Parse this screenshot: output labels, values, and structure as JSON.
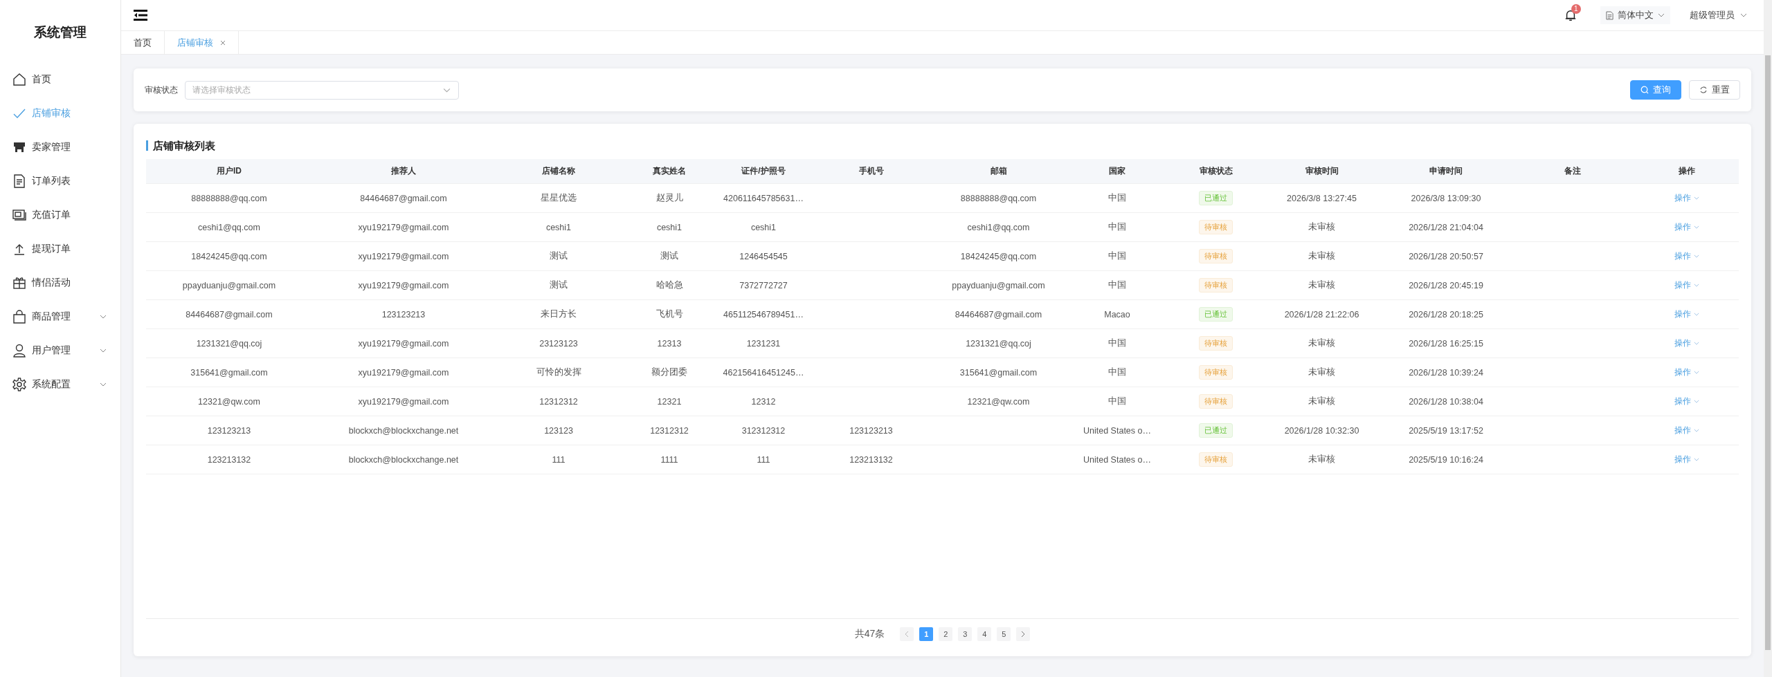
{
  "sidebar": {
    "title": "系统管理",
    "items": [
      {
        "label": "首页",
        "selected": false
      },
      {
        "label": "店铺审核",
        "selected": true
      },
      {
        "label": "卖家管理",
        "selected": false
      },
      {
        "label": "订单列表",
        "selected": false
      },
      {
        "label": "充值订单",
        "selected": false
      },
      {
        "label": "提现订单",
        "selected": false
      },
      {
        "label": "情侣活动",
        "selected": false
      },
      {
        "label": "商品管理",
        "selected": false,
        "expanded": false
      },
      {
        "label": "用户管理",
        "selected": false,
        "expanded": false
      },
      {
        "label": "系统配置",
        "selected": false,
        "expanded": false
      }
    ]
  },
  "header": {
    "notification_count": "1",
    "language": "简体中文",
    "user": "超级管理员"
  },
  "tabs": [
    {
      "label": "首页",
      "selected": false,
      "closable": false
    },
    {
      "label": "店铺审核",
      "selected": true,
      "closable": true
    }
  ],
  "filter": {
    "label": "审核状态",
    "placeholder": "请选择审核状态",
    "buttons": [
      {
        "label": "查询",
        "kind": "primary"
      },
      {
        "label": "重置",
        "kind": "default"
      }
    ]
  },
  "table": {
    "title": "店铺审核列表",
    "columns": [
      "用户ID",
      "推荐人",
      "店铺名称",
      "真实姓名",
      "证件/护照号",
      "手机号",
      "邮箱",
      "国家",
      "审核状态",
      "审核时间",
      "申请时间",
      "备注",
      "操作"
    ],
    "rows": [
      {
        "cells": [
          "88888888@qq.com",
          "84464687@gmail.com",
          "星星优选",
          "赵灵儿",
          "420611645785631…",
          "",
          "88888888@qq.com",
          "中国"
        ],
        "status": {
          "text": "已通过",
          "kind": "approved"
        },
        "review_time": "2026/3/8 13:27:45",
        "apply_time": "2026/3/8 13:09:30",
        "action": "操作"
      },
      {
        "cells": [
          "ceshi1@qq.com",
          "xyu192179@gmail.com",
          "ceshi1",
          "ceshi1",
          "ceshi1",
          "",
          "ceshi1@qq.com",
          "中国"
        ],
        "status": {
          "text": "待审核",
          "kind": "pending"
        },
        "review_time": "未审核",
        "apply_time": "2026/1/28 21:04:04",
        "action": "操作"
      },
      {
        "cells": [
          "18424245@qq.com",
          "xyu192179@gmail.com",
          "测试",
          "测试",
          "1246454545",
          "",
          "18424245@qq.com",
          "中国"
        ],
        "status": {
          "text": "待审核",
          "kind": "pending"
        },
        "review_time": "未审核",
        "apply_time": "2026/1/28 20:50:57",
        "action": "操作"
      },
      {
        "cells": [
          "ppayduanju@gmail.com",
          "xyu192179@gmail.com",
          "测试",
          "哈哈急",
          "7372772727",
          "",
          "ppayduanju@gmail.com",
          "中国"
        ],
        "status": {
          "text": "待审核",
          "kind": "pending"
        },
        "review_time": "未审核",
        "apply_time": "2026/1/28 20:45:19",
        "action": "操作"
      },
      {
        "cells": [
          "84464687@gmail.com",
          "123123213",
          "来日方长",
          "飞机号",
          "465112546789451…",
          "",
          "84464687@gmail.com",
          "Macao"
        ],
        "status": {
          "text": "已通过",
          "kind": "approved"
        },
        "review_time": "2026/1/28 21:22:06",
        "apply_time": "2026/1/28 20:18:25",
        "action": "操作"
      },
      {
        "cells": [
          "1231321@qq.coj",
          "xyu192179@gmail.com",
          "23123123",
          "12313",
          "1231231",
          "",
          "1231321@qq.coj",
          "中国"
        ],
        "status": {
          "text": "待审核",
          "kind": "pending"
        },
        "review_time": "未审核",
        "apply_time": "2026/1/28 16:25:15",
        "action": "操作"
      },
      {
        "cells": [
          "315641@gmail.com",
          "xyu192179@gmail.com",
          "可怜的发挥",
          "额分团委",
          "462156416451245…",
          "",
          "315641@gmail.com",
          "中国"
        ],
        "status": {
          "text": "待审核",
          "kind": "pending"
        },
        "review_time": "未审核",
        "apply_time": "2026/1/28 10:39:24",
        "action": "操作"
      },
      {
        "cells": [
          "12321@qw.com",
          "xyu192179@gmail.com",
          "12312312",
          "12321",
          "12312",
          "",
          "12321@qw.com",
          "中国"
        ],
        "status": {
          "text": "待审核",
          "kind": "pending"
        },
        "review_time": "未审核",
        "apply_time": "2026/1/28 10:38:04",
        "action": "操作"
      },
      {
        "cells": [
          "123123213",
          "blockxch@blockxchange.net",
          "123123",
          "12312312",
          "312312312",
          "123123213",
          "",
          "United States o…"
        ],
        "status": {
          "text": "已通过",
          "kind": "approved"
        },
        "review_time": "2026/1/28 10:32:30",
        "apply_time": "2025/5/19 13:17:52",
        "action": "操作"
      },
      {
        "cells": [
          "123213132",
          "blockxch@blockxchange.net",
          "111",
          "1111",
          "111",
          "123213132",
          "",
          "United States o…"
        ],
        "status": {
          "text": "待审核",
          "kind": "pending"
        },
        "review_time": "未审核",
        "apply_time": "2025/5/19 10:16:24",
        "action": "操作"
      }
    ]
  },
  "pagination": {
    "total": "共47条",
    "pages": [
      {
        "label": "1",
        "selected": true
      },
      {
        "label": "2",
        "selected": false
      },
      {
        "label": "3",
        "selected": false
      },
      {
        "label": "4",
        "selected": false
      },
      {
        "label": "5",
        "selected": false
      }
    ]
  }
}
